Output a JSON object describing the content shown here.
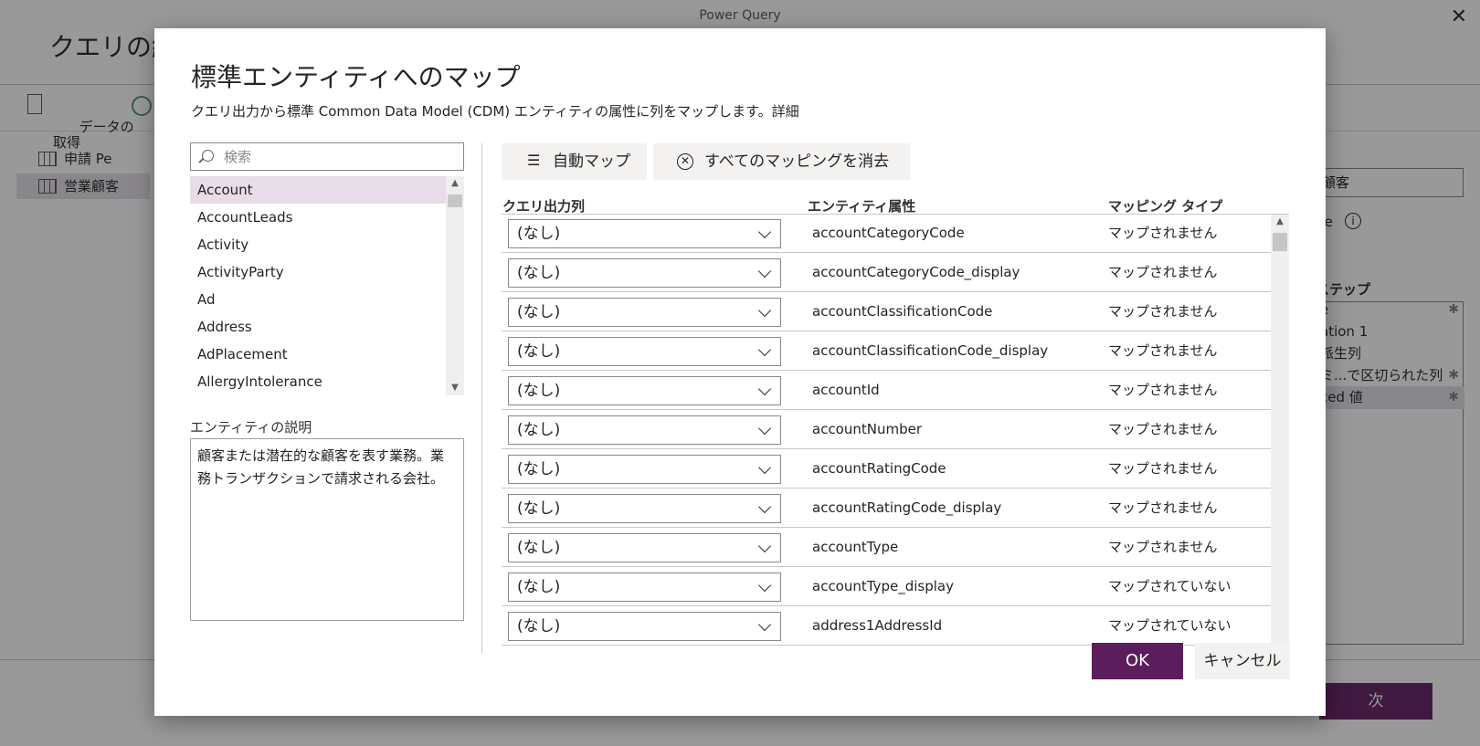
{
  "app": {
    "window_title": "Power Query",
    "heading": "クエリの編",
    "toolbar": {
      "get_data_label": "データの\n取得"
    },
    "queries": [
      {
        "name": "申請 Pe",
        "selected": false
      },
      {
        "name": "営業顧客",
        "selected": true
      }
    ],
    "right_panel": {
      "name_value": "顧客",
      "entity_type_label": "pe",
      "steps_heading": "ステップ",
      "steps": [
        {
          "label": "e",
          "gear": true,
          "selected": false
        },
        {
          "label": "ation 1",
          "gear": false,
          "selected": false
        },
        {
          "label": "派生列",
          "gear": false,
          "selected": false
        },
        {
          "label": "ミ...で区切られた列",
          "gear": true,
          "selected": false
        },
        {
          "label": "ced 値",
          "gear": true,
          "selected": true
        }
      ]
    },
    "next_label": "次"
  },
  "dialog": {
    "title": "標準エンティティへのマップ",
    "subtitle": "クエリ出力から標準 Common Data Model (CDM) エンティティの属性に列をマップします。詳細",
    "search_placeholder": "検索",
    "entities": [
      {
        "name": "Account",
        "selected": true
      },
      {
        "name": "AccountLeads",
        "selected": false
      },
      {
        "name": "Activity",
        "selected": false
      },
      {
        "name": "ActivityParty",
        "selected": false
      },
      {
        "name": "Ad",
        "selected": false
      },
      {
        "name": "Address",
        "selected": false
      },
      {
        "name": "AdPlacement",
        "selected": false
      },
      {
        "name": "AllergyIntolerance",
        "selected": false
      }
    ],
    "description_label": "エンティティの説明",
    "description": "顧客または潜在的な顧客を表す業務。業務トランザクションで請求される会社。",
    "auto_map_label": "自動マップ",
    "clear_all_label": "すべてのマッピングを消去",
    "columns": {
      "query_output": "クエリ出力列",
      "entity_attribute": "エンティティ属性",
      "mapping_type": "マッピング タイプ"
    },
    "rows": [
      {
        "query_col": "(なし)",
        "attribute": "accountCategoryCode",
        "mapping": "マップされません"
      },
      {
        "query_col": "(なし)",
        "attribute": "accountCategoryCode_display",
        "mapping": "マップされません"
      },
      {
        "query_col": "(なし)",
        "attribute": "accountClassificationCode",
        "mapping": "マップされません"
      },
      {
        "query_col": "(なし)",
        "attribute": "accountClassificationCode_display",
        "mapping": "マップされません"
      },
      {
        "query_col": "(なし)",
        "attribute": "accountId",
        "mapping": "マップされません"
      },
      {
        "query_col": "(なし)",
        "attribute": "accountNumber",
        "mapping": "マップされません"
      },
      {
        "query_col": "(なし)",
        "attribute": "accountRatingCode",
        "mapping": "マップされません"
      },
      {
        "query_col": "(なし)",
        "attribute": "accountRatingCode_display",
        "mapping": "マップされません"
      },
      {
        "query_col": "(なし)",
        "attribute": "accountType",
        "mapping": "マップされません"
      },
      {
        "query_col": "(なし)",
        "attribute": "accountType_display",
        "mapping": "マップされていない"
      },
      {
        "query_col": "(なし)",
        "attribute": "address1AddressId",
        "mapping": "マップされていない"
      }
    ],
    "ok_label": "OK",
    "cancel_label": "キャンセル"
  },
  "colors": {
    "accent": "#5c1d5c",
    "selection": "#e7dce7"
  }
}
